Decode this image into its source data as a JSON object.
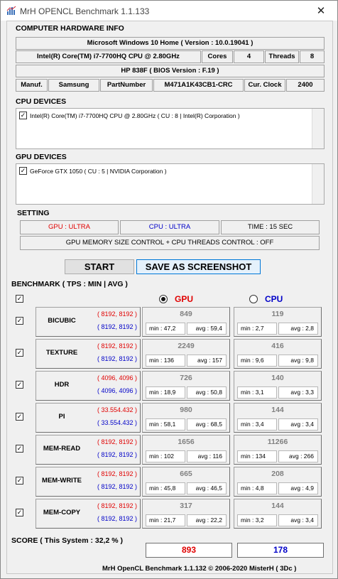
{
  "window": {
    "title": "MrH OPENCL Benchmark 1.1.133"
  },
  "hardware": {
    "section_title": "COMPUTER HARDWARE INFO",
    "os": "Microsoft Windows 10 Home ( Version : 10.0.19041 )",
    "cpu": "Intel(R) Core(TM) i7-7700HQ CPU @ 2.80GHz",
    "cores_label": "Cores",
    "cores_value": "4",
    "threads_label": "Threads",
    "threads_value": "8",
    "board": "HP 838F ( BIOS Version : F.19 )",
    "manuf_label": "Manuf.",
    "manuf_value": "Samsung",
    "part_label": "PartNumber",
    "part_value": "M471A1K43CB1-CRC",
    "clock_label": "Cur. Clock",
    "clock_value": "2400"
  },
  "cpu_devices": {
    "section_title": "CPU DEVICES",
    "items": [
      {
        "label": "Intel(R) Core(TM) i7-7700HQ CPU @ 2.80GHz ( CU : 8 | Intel(R) Corporation )",
        "checked": true
      }
    ]
  },
  "gpu_devices": {
    "section_title": "GPU DEVICES",
    "items": [
      {
        "label": "GeForce GTX 1050 ( CU : 5 | NVIDIA Corporation )",
        "checked": true
      }
    ]
  },
  "setting": {
    "section_title": "SETTING",
    "gpu": "GPU : ULTRA",
    "cpu": "CPU : ULTRA",
    "time": "TIME : 15 SEC",
    "control": "GPU MEMORY SIZE CONTROL + CPU THREADS CONTROL : OFF"
  },
  "buttons": {
    "start": "START",
    "save": "SAVE AS SCREENSHOT"
  },
  "benchmark": {
    "section_title": "BENCHMARK ( TPS : MIN | AVG )",
    "gpu_label": "GPU",
    "cpu_label": "CPU",
    "selected": "GPU",
    "rows": [
      {
        "name": "BICUBIC",
        "dim_gpu": "( 8192, 8192 )",
        "dim_cpu": "( 8192, 8192 )",
        "gpu": {
          "score": "849",
          "min": "min : 47,2",
          "avg": "avg : 59,4"
        },
        "cpu": {
          "score": "119",
          "min": "min : 2,7",
          "avg": "avg : 2,8"
        }
      },
      {
        "name": "TEXTURE",
        "dim_gpu": "( 8192, 8192 )",
        "dim_cpu": "( 8192, 8192 )",
        "gpu": {
          "score": "2249",
          "min": "min : 136",
          "avg": "avg : 157"
        },
        "cpu": {
          "score": "416",
          "min": "min : 9,6",
          "avg": "avg : 9,8"
        }
      },
      {
        "name": "HDR",
        "dim_gpu": "( 4096, 4096 )",
        "dim_cpu": "( 4096, 4096 )",
        "gpu": {
          "score": "726",
          "min": "min : 18,9",
          "avg": "avg : 50,8"
        },
        "cpu": {
          "score": "140",
          "min": "min : 3,1",
          "avg": "avg : 3,3"
        }
      },
      {
        "name": "PI",
        "dim_gpu": "( 33.554.432 )",
        "dim_cpu": "( 33.554.432 )",
        "gpu": {
          "score": "980",
          "min": "min : 58,1",
          "avg": "avg : 68,5"
        },
        "cpu": {
          "score": "144",
          "min": "min : 3,4",
          "avg": "avg : 3,4"
        }
      },
      {
        "name": "MEM-READ",
        "dim_gpu": "( 8192, 8192 )",
        "dim_cpu": "( 8192, 8192 )",
        "gpu": {
          "score": "1656",
          "min": "min : 102",
          "avg": "avg : 116"
        },
        "cpu": {
          "score": "11266",
          "min": "min : 134",
          "avg": "avg : 266"
        }
      },
      {
        "name": "MEM-WRITE",
        "dim_gpu": "( 8192, 8192 )",
        "dim_cpu": "( 8192, 8192 )",
        "gpu": {
          "score": "665",
          "min": "min : 45,8",
          "avg": "avg : 46,5"
        },
        "cpu": {
          "score": "208",
          "min": "min : 4,8",
          "avg": "avg : 4,9"
        }
      },
      {
        "name": "MEM-COPY",
        "dim_gpu": "( 8192, 8192 )",
        "dim_cpu": "( 8192, 8192 )",
        "gpu": {
          "score": "317",
          "min": "min : 21,7",
          "avg": "avg : 22,2"
        },
        "cpu": {
          "score": "144",
          "min": "min : 3,2",
          "avg": "avg : 3,4"
        }
      }
    ]
  },
  "score": {
    "label": "SCORE ( This System : 32,2 % )",
    "gpu": "893",
    "cpu": "178"
  },
  "footer": "MrH OpenCL Benchmark 1.1.132 © 2006-2020 MisterH ( 3Dc )",
  "colors": {
    "gpu": "#e00000",
    "cpu": "#0000c8",
    "save_border": "#0078d7"
  }
}
